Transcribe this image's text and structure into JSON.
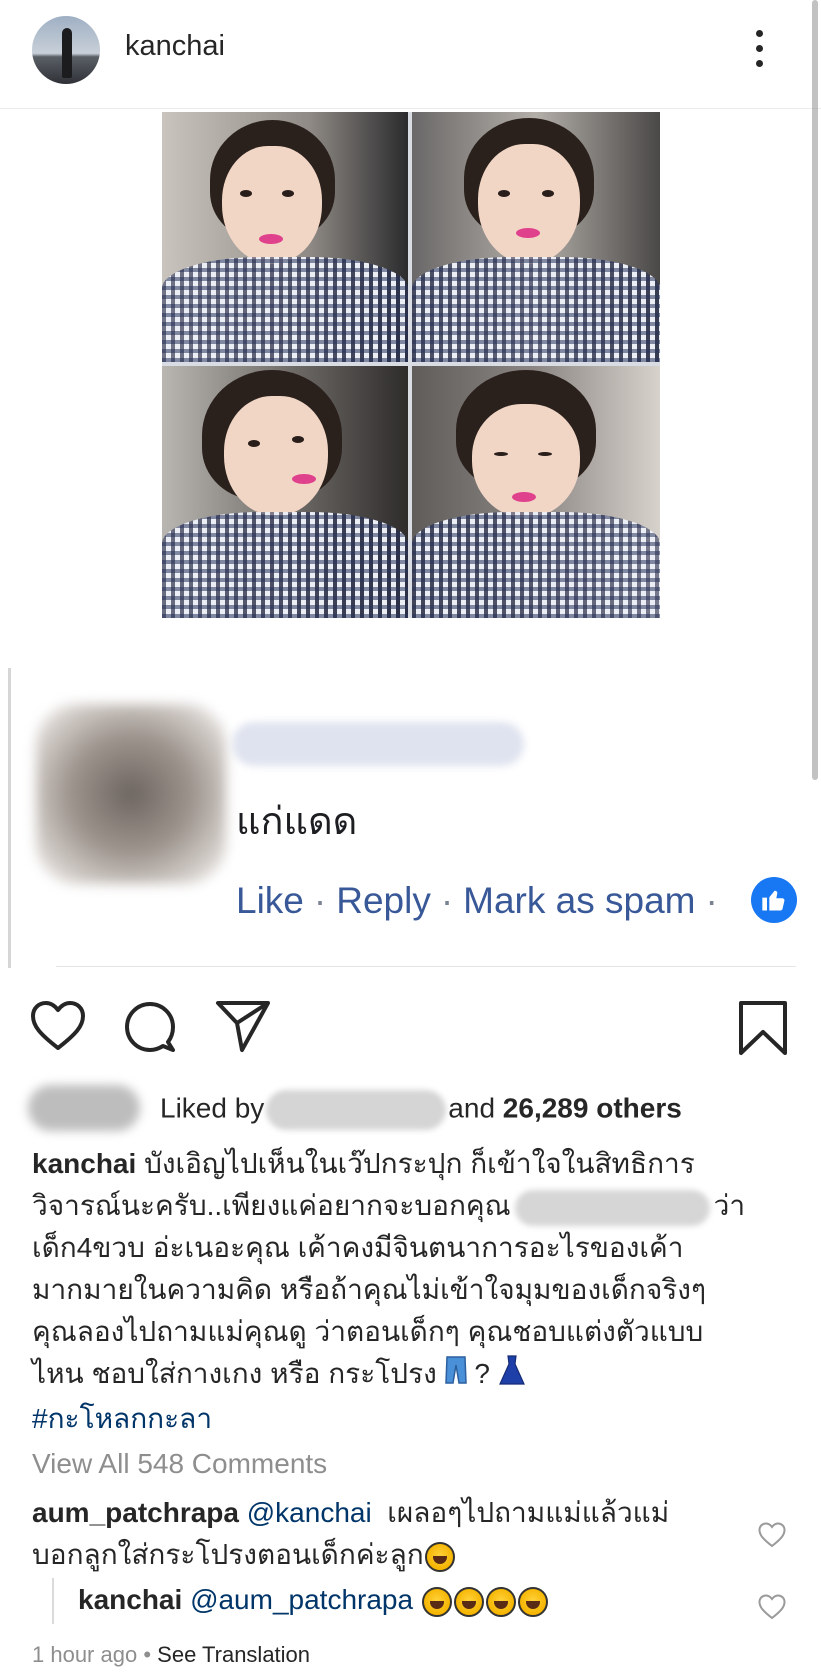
{
  "post": {
    "username": "kanchai"
  },
  "fb_comment": {
    "text": "แก่แดด",
    "actions": [
      "Like",
      "Reply",
      "Mark as spam"
    ]
  },
  "likes": {
    "prefix": "Liked by",
    "connector": "and",
    "count_text": "26,289 others"
  },
  "caption": {
    "username": "kanchai",
    "lines": [
      "บังเอิญไปเห็นในเว๊ปกระปุก ก็เข้าใจในสิทธิการ",
      "วิจารณ์นะครับ..เพียงแค่อยากจะบอกคุณ",
      "ว่า",
      "เด็ก4ขวบ อ่ะเนอะคุณ เค้าคงมีจินตนาการอะไรของเค้า",
      "มากมายในความคิด หรือถ้าคุณไม่เข้าใจมุมของเด็กจริงๆ",
      "คุณลองไปถามแม่คุณดู ว่าตอนเด็กๆ คุณชอบแต่งตัวแบบ",
      "ไหน ชอบใส่กางเกง หรือ กระโปรง",
      "?"
    ],
    "hashtag": "#กะโหลกกะลา"
  },
  "view_all_comments": "View All 548 Comments",
  "comments": [
    {
      "username": "aum_patchrapa",
      "mention": "@kanchai",
      "text_line1": "เผลอๆไปถามแม่แล้วแม่",
      "text_line2": "บอกลูกใส่กระโปรงตอนเด็กค่ะลูก"
    },
    {
      "username": "kanchai",
      "mention": "@aum_patchrapa"
    }
  ],
  "footer": {
    "time": "1 hour ago",
    "separator": "•",
    "see_translation": "See Translation"
  },
  "colors": {
    "text": "#262626",
    "muted": "#8e8e8e",
    "link": "#003569",
    "fb_link": "#385898",
    "fb_blue": "#1877f2"
  },
  "icons": [
    "more-icon",
    "heart-icon",
    "comment-icon",
    "share-icon",
    "bookmark-icon",
    "like-thumb-icon",
    "jeans-emoji",
    "dress-emoji",
    "laughing-emoji"
  ]
}
